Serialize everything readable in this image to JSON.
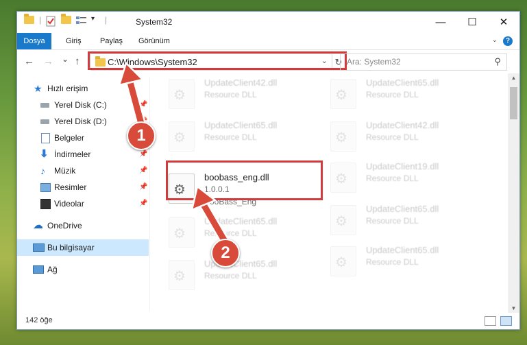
{
  "window": {
    "title": "System32",
    "controls": {
      "minimize": "—",
      "maximize": "☐",
      "close": "✕"
    }
  },
  "ribbon": {
    "tabs": [
      {
        "label": "Dosya",
        "active": true
      },
      {
        "label": "Giriş"
      },
      {
        "label": "Paylaş"
      },
      {
        "label": "Görünüm"
      }
    ],
    "help": "?"
  },
  "navigation": {
    "back": "←",
    "forward": "→",
    "recent": "⌄",
    "up": "↑",
    "address": "C:\\Windows\\System32",
    "search_placeholder": "Ara: System32"
  },
  "sidebar": {
    "items": [
      {
        "label": "Hızlı erişim",
        "icon": "star-icon",
        "pinned": false
      },
      {
        "label": "Yerel Disk (C:)",
        "icon": "drive-icon",
        "pinned": true
      },
      {
        "label": "Yerel Disk (D:)",
        "icon": "drive-icon",
        "pinned": true
      },
      {
        "label": "Belgeler",
        "icon": "documents-icon",
        "pinned": false
      },
      {
        "label": "İndirmeler",
        "icon": "download-icon",
        "pinned": true
      },
      {
        "label": "Müzik",
        "icon": "music-icon",
        "pinned": true
      },
      {
        "label": "Resimler",
        "icon": "pictures-icon",
        "pinned": true
      },
      {
        "label": "Videolar",
        "icon": "video-icon",
        "pinned": true
      },
      {
        "label": "OneDrive",
        "icon": "cloud-icon",
        "pinned": false
      },
      {
        "label": "Bu bilgisayar",
        "icon": "computer-icon",
        "pinned": false,
        "selected": true
      },
      {
        "label": "Ağ",
        "icon": "network-icon",
        "pinned": false
      }
    ]
  },
  "files": {
    "highlighted": {
      "name": "boobass_eng.dll",
      "version": "1.0.0.1",
      "description": "BooBass_Eng"
    },
    "faded": [
      {
        "name": "UpdateClient42.dll",
        "type": "Resource DLL"
      },
      {
        "name": "UpdateClient65.dll",
        "type": "Resource DLL"
      },
      {
        "name": "UpdateClient65.dll",
        "type": "Resource DLL"
      },
      {
        "name": "UpdateClient42.dll",
        "type": "Resource DLL"
      },
      {
        "name": "UpdateClient19.dll",
        "type": "Resource DLL"
      },
      {
        "name": "UpdateClient65.dll",
        "type": "Resource DLL"
      },
      {
        "name": "UpdateClient65.dll",
        "type": "Resource DLL"
      },
      {
        "name": "UpdateClient65.dll",
        "type": "Resource DLL"
      },
      {
        "name": "UpdateClient65.dll",
        "type": "Resource DLL"
      }
    ]
  },
  "status": {
    "item_count": "142 öğe"
  },
  "annotations": {
    "step1": "1",
    "step2": "2",
    "color": "#d23b3b"
  }
}
